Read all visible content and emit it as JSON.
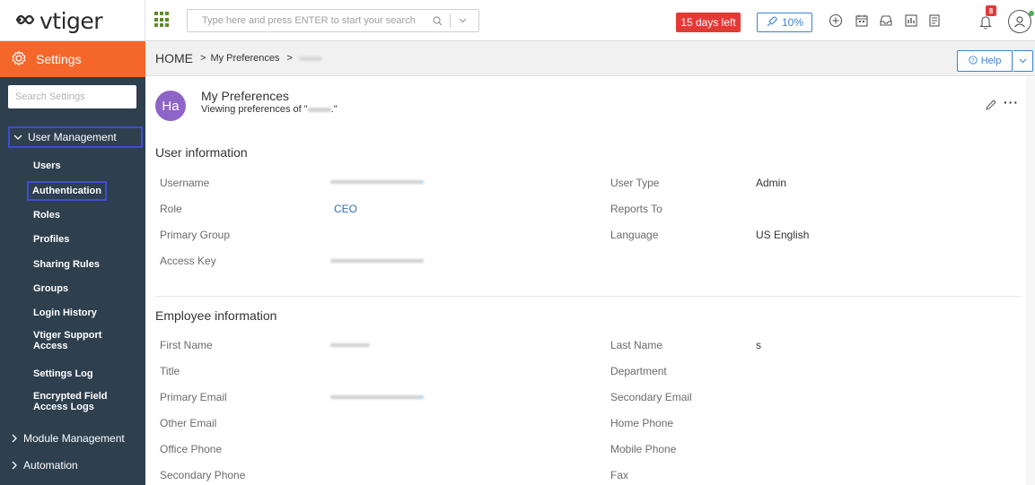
{
  "header": {
    "logo_text": "vtiger",
    "search_placeholder": "Type here and press ENTER to start your search",
    "trial_label": "15 days left",
    "progress_label": "10%",
    "notification_count": "8",
    "accent_color": "#f5662b",
    "trial_color": "#e53935",
    "link_color": "#3b83d6"
  },
  "sidebar": {
    "title": "Settings",
    "search_placeholder": "Search Settings",
    "user_management_label": "User Management",
    "items": [
      {
        "label": "Users"
      },
      {
        "label": "Authentication"
      },
      {
        "label": "Roles"
      },
      {
        "label": "Profiles"
      },
      {
        "label": "Sharing Rules"
      },
      {
        "label": "Groups"
      },
      {
        "label": "Login History"
      },
      {
        "label": "Vtiger Support Access"
      },
      {
        "label": "Settings Log"
      },
      {
        "label": "Encrypted Field Access Logs"
      }
    ],
    "module_management_label": "Module Management",
    "automation_label": "Automation"
  },
  "breadcrumb": {
    "home": "HOME",
    "my_preferences": "My Preferences"
  },
  "help": {
    "label": "Help"
  },
  "preferences": {
    "avatar_initials": "Ha",
    "title": "My Preferences",
    "subtitle_prefix": "Viewing preferences of \"",
    "subtitle_suffix": ".\""
  },
  "user_information": {
    "title": "User information",
    "username_label": "Username",
    "role_label": "Role",
    "role_value": "CEO",
    "primary_group_label": "Primary Group",
    "access_key_label": "Access Key",
    "user_type_label": "User Type",
    "user_type_value": "Admin",
    "reports_to_label": "Reports To",
    "language_label": "Language",
    "language_value": "US English"
  },
  "employee_information": {
    "title": "Employee information",
    "first_name_label": "First Name",
    "title_label": "Title",
    "primary_email_label": "Primary Email",
    "other_email_label": "Other Email",
    "office_phone_label": "Office Phone",
    "secondary_phone_label": "Secondary Phone",
    "last_name_label": "Last Name",
    "last_name_value": "s",
    "department_label": "Department",
    "secondary_email_label": "Secondary Email",
    "home_phone_label": "Home Phone",
    "mobile_phone_label": "Mobile Phone",
    "fax_label": "Fax"
  }
}
